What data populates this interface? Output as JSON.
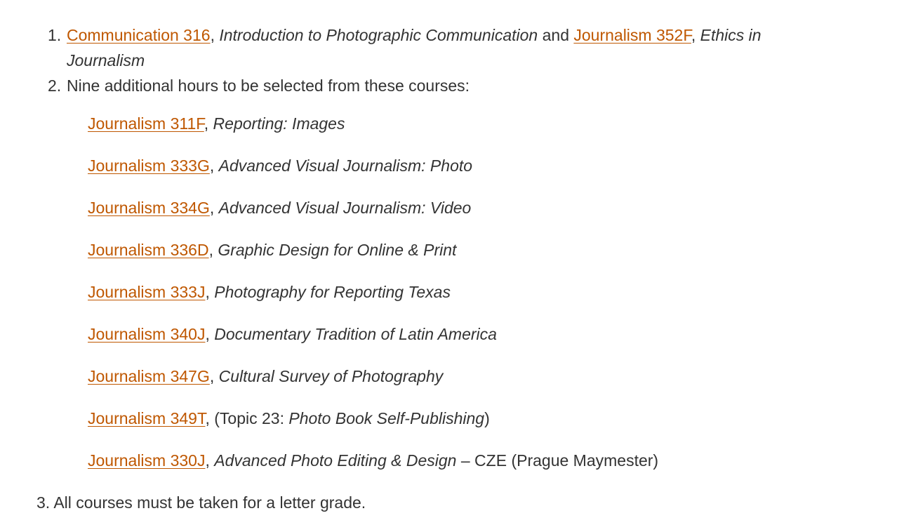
{
  "list": {
    "item1": {
      "number": "1.",
      "link1": "Communication 316",
      "sep1": ", ",
      "title1": "Introduction to Photographic Communication",
      "conj": " and ",
      "link2": "Journalism 352F",
      "sep2": ", ",
      "title2_a": "Ethics in",
      "title2_b": "Journalism"
    },
    "item2": {
      "number": "2.",
      "text": "Nine additional hours to be selected from these courses:"
    },
    "courses": [
      {
        "code": "Journalism 311F",
        "title": "Reporting: Images"
      },
      {
        "code": "Journalism 333G",
        "title": "Advanced Visual Journalism: Photo"
      },
      {
        "code": "Journalism 334G",
        "title": "Advanced Visual Journalism: Video"
      },
      {
        "code": "Journalism 336D",
        "title": "Graphic Design for Online & Print"
      },
      {
        "code": "Journalism 333J",
        "title": "Photography for Reporting Texas"
      },
      {
        "code": "Journalism 340J",
        "title": "Documentary Tradition of Latin America"
      },
      {
        "code": "Journalism 347G",
        "title": "Cultural Survey of Photography"
      },
      {
        "code": "Journalism 349T",
        "pre": "(Topic 23: ",
        "title": "Photo Book Self-Publishing",
        "post": ")"
      },
      {
        "code": "Journalism 330J",
        "title": "Advanced Photo Editing & Design",
        "post": " – CZE (Prague Maymester)"
      }
    ],
    "item3": {
      "number": "3.",
      "text": "All courses must be taken for a letter grade."
    }
  },
  "colors": {
    "link": "#bf5700",
    "text": "#333333"
  }
}
